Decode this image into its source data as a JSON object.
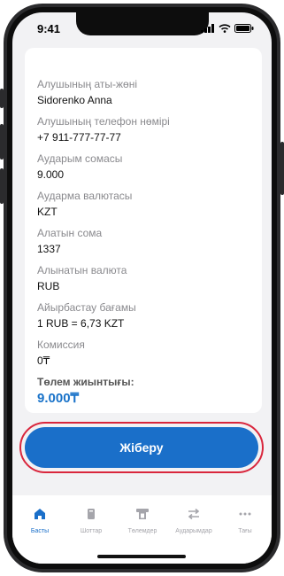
{
  "status": {
    "time": "9:41"
  },
  "details": [
    {
      "label": "Алушының аты-жөні",
      "value": "Sidorenko Anna"
    },
    {
      "label": "Алушының телефон нөмірі",
      "value": "+7 911-777-77-77"
    },
    {
      "label": "Аударым сомасы",
      "value": "9.000"
    },
    {
      "label": "Аударма валютасы",
      "value": "KZT"
    },
    {
      "label": "Алатын сома",
      "value": "1337"
    },
    {
      "label": "Алынатын валюта",
      "value": "RUB"
    },
    {
      "label": "Айырбастау бағамы",
      "value": "1 RUB = 6,73 KZT"
    },
    {
      "label": "Комиссия",
      "value": "0₸"
    }
  ],
  "total": {
    "label": "Төлем жиынтығы:",
    "value": "9.000₸"
  },
  "send_button": {
    "label": "Жіберу"
  },
  "tabs": [
    {
      "label": "Басты",
      "icon": "home-icon",
      "active": true
    },
    {
      "label": "Шоттар",
      "icon": "card-icon"
    },
    {
      "label": "Төлемдер",
      "icon": "payment-icon"
    },
    {
      "label": "Аударымдар",
      "icon": "transfer-icon"
    },
    {
      "label": "Тағы",
      "icon": "more-icon"
    }
  ],
  "colors": {
    "accent": "#1a6fc9",
    "highlight_ring": "#d9263c",
    "total": "#1a73c9"
  }
}
